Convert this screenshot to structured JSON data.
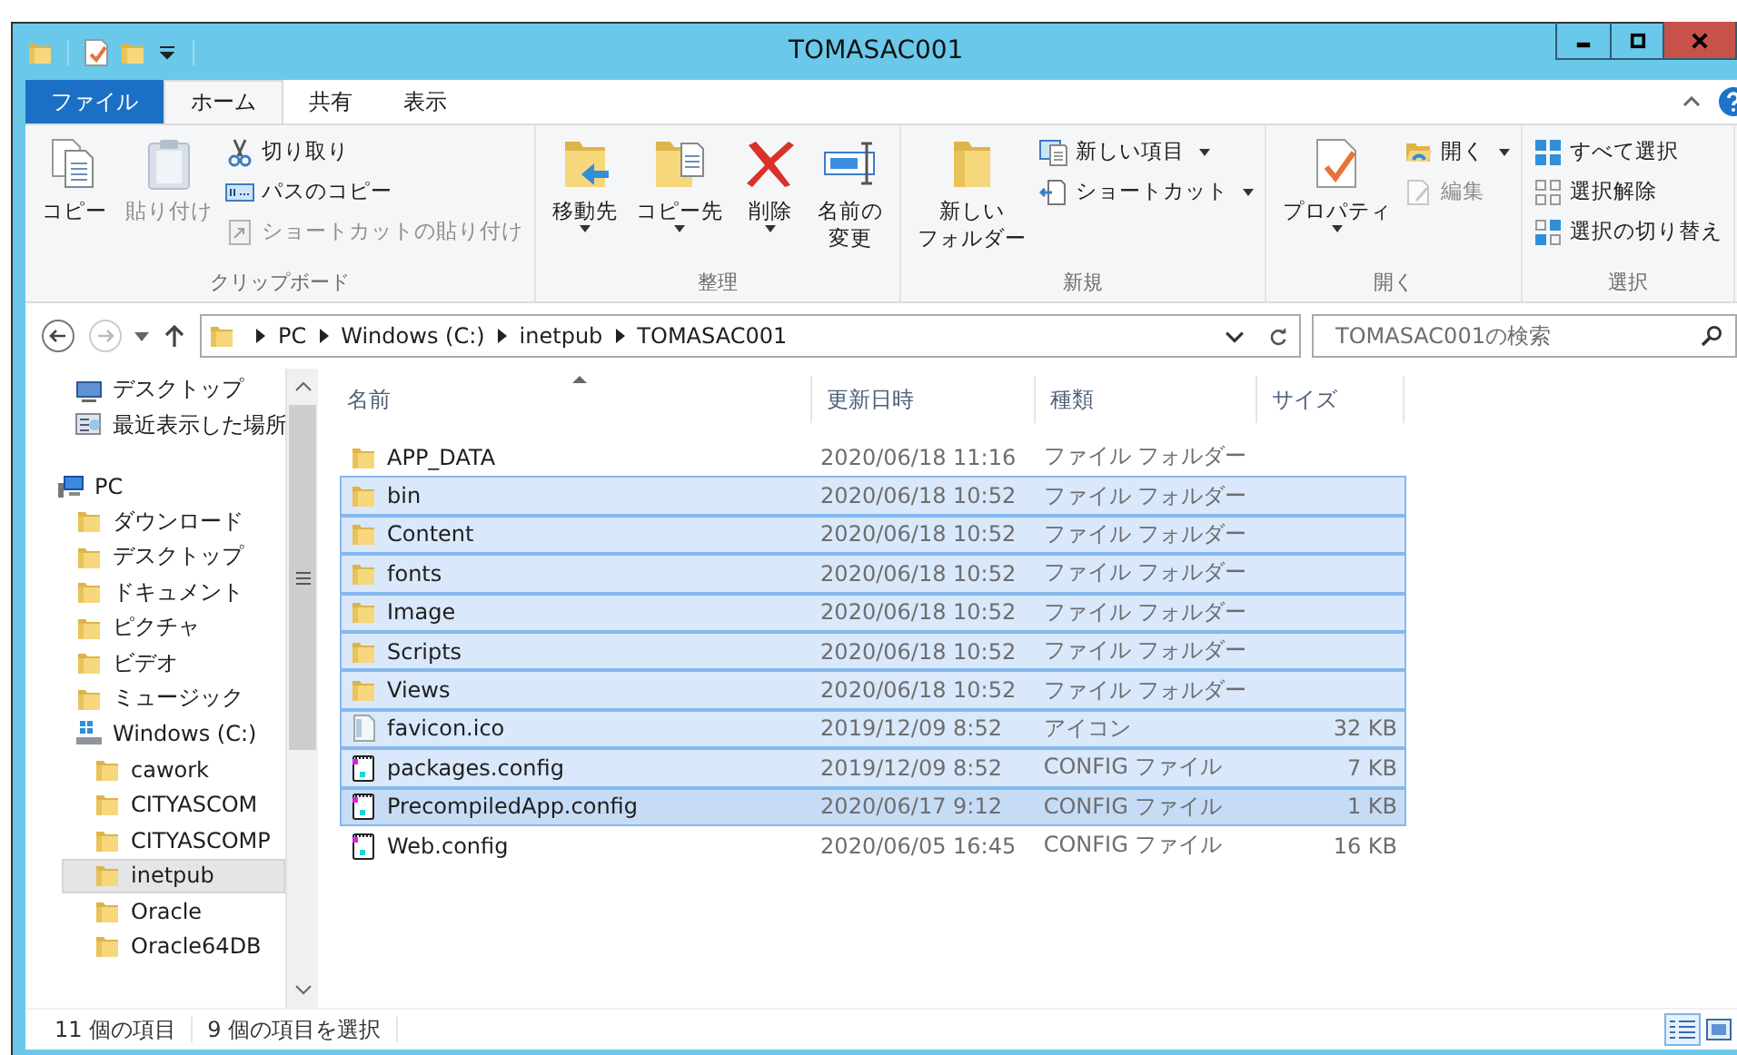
{
  "window": {
    "title": "TOMASAC001"
  },
  "ribbon": {
    "tabs": [
      {
        "label": "ファイル",
        "kind": "file",
        "selected": false
      },
      {
        "label": "ホーム",
        "kind": "tab",
        "selected": true
      },
      {
        "label": "共有",
        "kind": "tab",
        "selected": false
      },
      {
        "label": "表示",
        "kind": "tab",
        "selected": false
      }
    ],
    "groups": [
      {
        "label": "クリップボード",
        "items": [
          {
            "lines": [
              "コピー"
            ],
            "kind": "large",
            "disabled": false,
            "dropdown": false
          },
          {
            "lines": [
              "貼り付け"
            ],
            "kind": "large",
            "disabled": true,
            "dropdown": false
          },
          {
            "lines": [
              "切り取り"
            ],
            "kind": "small",
            "disabled": false,
            "dropdown": false
          },
          {
            "lines": [
              "パスのコピー"
            ],
            "kind": "small",
            "disabled": false,
            "dropdown": false
          },
          {
            "lines": [
              "ショートカットの貼り付け"
            ],
            "kind": "small",
            "disabled": true,
            "dropdown": false
          }
        ]
      },
      {
        "label": "整理",
        "items": [
          {
            "lines": [
              "移動先"
            ],
            "kind": "large",
            "disabled": false,
            "dropdown": true
          },
          {
            "lines": [
              "コピー先"
            ],
            "kind": "large",
            "disabled": false,
            "dropdown": true
          },
          {
            "lines": [
              "削除"
            ],
            "kind": "large",
            "disabled": false,
            "dropdown": true
          },
          {
            "lines": [
              "名前の",
              "変更"
            ],
            "kind": "large",
            "disabled": false,
            "dropdown": false
          }
        ]
      },
      {
        "label": "新規",
        "items": [
          {
            "lines": [
              "新しい",
              "フォルダー"
            ],
            "kind": "large",
            "disabled": false,
            "dropdown": false
          },
          {
            "lines": [
              "新しい項目"
            ],
            "kind": "small",
            "disabled": false,
            "dropdown": true
          },
          {
            "lines": [
              "ショートカット"
            ],
            "kind": "small",
            "disabled": false,
            "dropdown": true
          }
        ]
      },
      {
        "label": "開く",
        "items": [
          {
            "lines": [
              "プロパティ"
            ],
            "kind": "large",
            "disabled": false,
            "dropdown": true
          },
          {
            "lines": [
              "開く"
            ],
            "kind": "small",
            "disabled": false,
            "dropdown": true
          },
          {
            "lines": [
              "編集"
            ],
            "kind": "small",
            "disabled": true,
            "dropdown": false
          }
        ]
      },
      {
        "label": "選択",
        "items": [
          {
            "lines": [
              "すべて選択"
            ],
            "kind": "small",
            "disabled": false,
            "dropdown": false
          },
          {
            "lines": [
              "選択解除"
            ],
            "kind": "small",
            "disabled": false,
            "dropdown": false
          },
          {
            "lines": [
              "選択の切り替え"
            ],
            "kind": "small",
            "disabled": false,
            "dropdown": false
          }
        ]
      }
    ]
  },
  "address_bar": {
    "breadcrumb": [
      "PC",
      "Windows (C:)",
      "inetpub",
      "TOMASAC001"
    ]
  },
  "search": {
    "placeholder": "TOMASAC001の検索"
  },
  "nav_pane": {
    "sections": [
      {
        "items": [
          {
            "label": "デスクトップ",
            "kind": "desktop",
            "selected": false
          },
          {
            "label": "最近表示した場所",
            "kind": "recent",
            "selected": false
          }
        ]
      },
      {
        "items": [
          {
            "label": "PC",
            "kind": "computer",
            "selected": false,
            "children": [
              {
                "label": "ダウンロード",
                "kind": "folder",
                "selected": false
              },
              {
                "label": "デスクトップ",
                "kind": "folder",
                "selected": false
              },
              {
                "label": "ドキュメント",
                "kind": "folder",
                "selected": false
              },
              {
                "label": "ピクチャ",
                "kind": "folder",
                "selected": false
              },
              {
                "label": "ビデオ",
                "kind": "folder",
                "selected": false
              },
              {
                "label": "ミュージック",
                "kind": "folder",
                "selected": false
              },
              {
                "label": "Windows (C:)",
                "kind": "drive",
                "selected": false,
                "children": [
                  {
                    "label": "cawork",
                    "kind": "folder",
                    "selected": false
                  },
                  {
                    "label": "CITYASCOM",
                    "kind": "folder",
                    "selected": false
                  },
                  {
                    "label": "CITYASCOMP",
                    "kind": "folder",
                    "selected": false
                  },
                  {
                    "label": "inetpub",
                    "kind": "folder",
                    "selected": true
                  },
                  {
                    "label": "Oracle",
                    "kind": "folder",
                    "selected": false
                  },
                  {
                    "label": "Oracle64DB",
                    "kind": "folder",
                    "selected": false
                  }
                ]
              }
            ]
          }
        ]
      }
    ]
  },
  "file_list": {
    "columns": [
      {
        "label": "名前",
        "sorted": true
      },
      {
        "label": "更新日時",
        "sorted": false
      },
      {
        "label": "種類",
        "sorted": false
      },
      {
        "label": "サイズ",
        "sorted": false
      }
    ],
    "rows": [
      {
        "name": "APP_DATA",
        "modified": "2020/06/18 11:16",
        "type": "ファイル フォルダー",
        "kind": "folder",
        "selected": false,
        "focused": false
      },
      {
        "name": "bin",
        "modified": "2020/06/18 10:52",
        "type": "ファイル フォルダー",
        "kind": "folder",
        "selected": true,
        "focused": false
      },
      {
        "name": "Content",
        "modified": "2020/06/18 10:52",
        "type": "ファイル フォルダー",
        "kind": "folder",
        "selected": true,
        "focused": false
      },
      {
        "name": "fonts",
        "modified": "2020/06/18 10:52",
        "type": "ファイル フォルダー",
        "kind": "folder",
        "selected": true,
        "focused": false
      },
      {
        "name": "Image",
        "modified": "2020/06/18 10:52",
        "type": "ファイル フォルダー",
        "kind": "folder",
        "selected": true,
        "focused": false
      },
      {
        "name": "Scripts",
        "modified": "2020/06/18 10:52",
        "type": "ファイル フォルダー",
        "kind": "folder",
        "selected": true,
        "focused": false
      },
      {
        "name": "Views",
        "modified": "2020/06/18 10:52",
        "type": "ファイル フォルダー",
        "kind": "folder",
        "selected": true,
        "focused": false
      },
      {
        "name": "favicon.ico",
        "modified": "2019/12/09 8:52",
        "type": "アイコン",
        "size": "32 KB",
        "kind": "image",
        "selected": true,
        "focused": false
      },
      {
        "name": "packages.config",
        "modified": "2019/12/09 8:52",
        "type": "CONFIG ファイル",
        "size": "7 KB",
        "kind": "config",
        "selected": true,
        "focused": false
      },
      {
        "name": "PrecompiledApp.config",
        "modified": "2020/06/17 9:12",
        "type": "CONFIG ファイル",
        "size": "1 KB",
        "kind": "config",
        "selected": true,
        "focused": true
      },
      {
        "name": "Web.config",
        "modified": "2020/06/05 16:45",
        "type": "CONFIG ファイル",
        "size": "16 KB",
        "kind": "config",
        "selected": false,
        "focused": false
      }
    ]
  },
  "status_bar": {
    "item_count": "11 個の項目",
    "selection_count": "9 個の項目を選択",
    "views": [
      {
        "selected": true
      },
      {
        "selected": false
      }
    ]
  }
}
